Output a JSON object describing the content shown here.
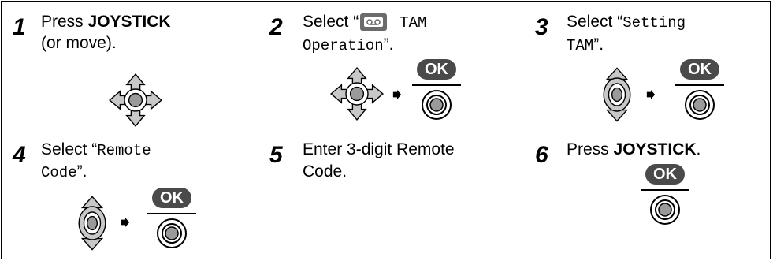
{
  "steps": [
    {
      "num": "1",
      "line1_a": "Press ",
      "line1_b": "JOYSTICK",
      "line2": "(or move)."
    },
    {
      "num": "2",
      "line1_a": "Select “",
      "line1_b": "TAM",
      "line2_a": "Operation",
      "line2_b": "”."
    },
    {
      "num": "3",
      "line1_a": "Select “",
      "line1_b": "Setting",
      "line2_a": "TAM",
      "line2_b": "”."
    },
    {
      "num": "4",
      "line1_a": "Select “",
      "line1_b": "Remote",
      "line2_a": "Code",
      "line2_b": "”."
    },
    {
      "num": "5",
      "line1": "Enter 3-digit Remote",
      "line2": "Code."
    },
    {
      "num": "6",
      "line1_a": "Press ",
      "line1_b": "JOYSTICK",
      "line1_c": "."
    }
  ],
  "ok_label": "OK",
  "icons": {
    "joystick_4way": "joystick-4way-icon",
    "joystick_updown": "joystick-updown-icon",
    "answering_machine": "tam-icon",
    "next_arrow": "right-arrow-icon",
    "ok_button": "ok-button-icon"
  },
  "colors": {
    "ok_bg": "#4a4a4a",
    "joystick_fill": "#c8c8c8"
  }
}
